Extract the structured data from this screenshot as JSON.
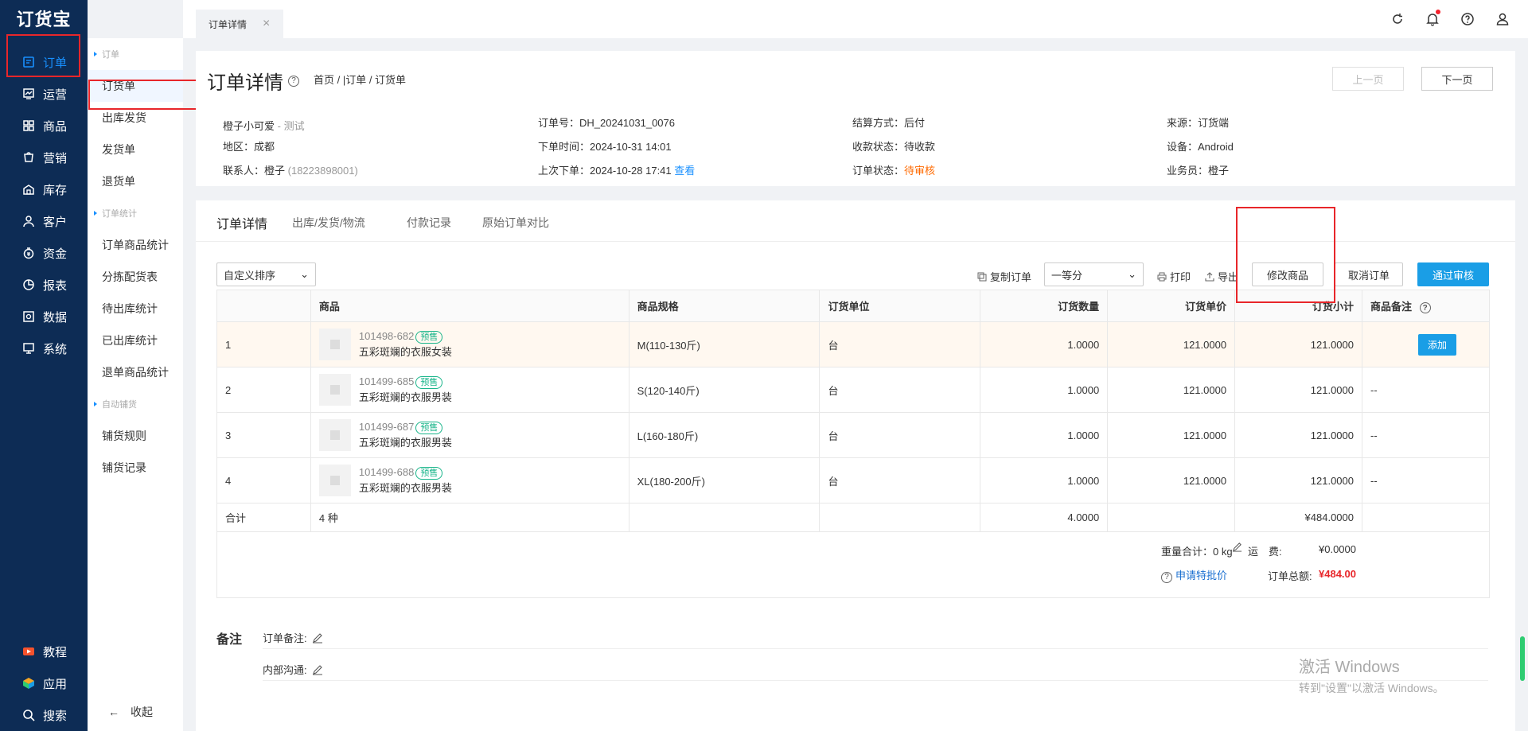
{
  "app": {
    "logo": "订货宝"
  },
  "leftnav": {
    "items": [
      {
        "label": "订单",
        "icon": "order-icon"
      },
      {
        "label": "运营",
        "icon": "operation-icon"
      },
      {
        "label": "商品",
        "icon": "goods-icon"
      },
      {
        "label": "营销",
        "icon": "marketing-icon"
      },
      {
        "label": "库存",
        "icon": "stock-icon"
      },
      {
        "label": "客户",
        "icon": "customer-icon"
      },
      {
        "label": "资金",
        "icon": "money-icon"
      },
      {
        "label": "报表",
        "icon": "report-icon"
      },
      {
        "label": "数据",
        "icon": "data-icon"
      },
      {
        "label": "系统",
        "icon": "system-icon"
      }
    ],
    "bottom": [
      {
        "label": "教程",
        "icon": "tutorial-icon"
      },
      {
        "label": "应用",
        "icon": "app-icon"
      },
      {
        "label": "搜索",
        "icon": "search-icon"
      }
    ]
  },
  "subnav": {
    "group1": "订单",
    "g1items": [
      "订货单",
      "出库发货",
      "发货单",
      "退货单"
    ],
    "group2": "订单统计",
    "g2items": [
      "订单商品统计",
      "分拣配货表",
      "待出库统计",
      "已出库统计",
      "退单商品统计"
    ],
    "group3": "自动铺货",
    "g3items": [
      "铺货规则",
      "铺货记录"
    ],
    "collapse": "收起"
  },
  "topbar": {
    "tab_label": "订单详情",
    "tab_close": "×"
  },
  "header": {
    "title": "订单详情",
    "help": "?",
    "breadcrumb": "首页 / |订单 / 订货单",
    "prev": "上一页",
    "next": "下一页",
    "customer": "橙子小可爱",
    "customer_tag": "- 测试",
    "region": "地区：成都",
    "contact": "联系人：橙子",
    "phone": "(18223898001)",
    "order_no": "订单号：DH_20241031_0076",
    "order_time": "下单时间：2024-10-31 14:01",
    "last_order": "上次下单：2024-10-28 17:41",
    "view": "查看",
    "settle": "结算方式：后付",
    "pay_status": "收款状态：待收款",
    "order_status_label": "订单状态：",
    "order_status": "待审核",
    "source": "来源：订货端",
    "device": "设备：Android",
    "salesman": "业务员：橙子"
  },
  "detail_tabs": [
    "订单详情",
    "出库/发货/物流",
    "付款记录",
    "原始订单对比"
  ],
  "toolbar": {
    "sort": "自定义排序",
    "copy": "复制订单",
    "level": "一等分",
    "print": "打印",
    "export": "导出",
    "modify": "修改商品",
    "cancel": "取消订单",
    "approve": "通过审核"
  },
  "table": {
    "headers": [
      "",
      "商品",
      "商品规格",
      "订货单位",
      "订货数量",
      "订货单价",
      "订货小计",
      "商品备注"
    ],
    "rows": [
      {
        "no": "1",
        "code": "101498-682",
        "tag": "预售",
        "name": "五彩斑斓的衣服女装",
        "spec": "M(110-130斤)",
        "unit": "台",
        "qty": "1.0000",
        "price": "121.0000",
        "subtotal": "121.0000",
        "remark": "添加"
      },
      {
        "no": "2",
        "code": "101499-685",
        "tag": "预售",
        "name": "五彩斑斓的衣服男装",
        "spec": "S(120-140斤)",
        "unit": "台",
        "qty": "1.0000",
        "price": "121.0000",
        "subtotal": "121.0000",
        "remark": "--"
      },
      {
        "no": "3",
        "code": "101499-687",
        "tag": "预售",
        "name": "五彩斑斓的衣服男装",
        "spec": "L(160-180斤)",
        "unit": "台",
        "qty": "1.0000",
        "price": "121.0000",
        "subtotal": "121.0000",
        "remark": "--"
      },
      {
        "no": "4",
        "code": "101499-688",
        "tag": "预售",
        "name": "五彩斑斓的衣服男装",
        "spec": "XL(180-200斤)",
        "unit": "台",
        "qty": "1.0000",
        "price": "121.0000",
        "subtotal": "121.0000",
        "remark": "--"
      }
    ],
    "sum": {
      "label": "合计",
      "kinds": "4 种",
      "qty": "4.0000",
      "subtotal": "¥484.0000"
    }
  },
  "totals": {
    "weight": "重量合计：0 kg",
    "freight_label": "运　费:",
    "freight": "¥0.0000",
    "special": "申请特批价",
    "total_label": "订单总额:",
    "total": "¥484.00"
  },
  "remarks": {
    "title": "备注",
    "order_remark": "订单备注:",
    "internal": "内部沟通:"
  },
  "watermark": {
    "line1": "激活 Windows",
    "line2": "转到\"设置\"以激活 Windows。"
  },
  "colors": {
    "nav_bg": "#0d2c55",
    "accent": "#1a9ee6",
    "highlight": "#e8262a",
    "status_orange": "#ff6a00"
  }
}
